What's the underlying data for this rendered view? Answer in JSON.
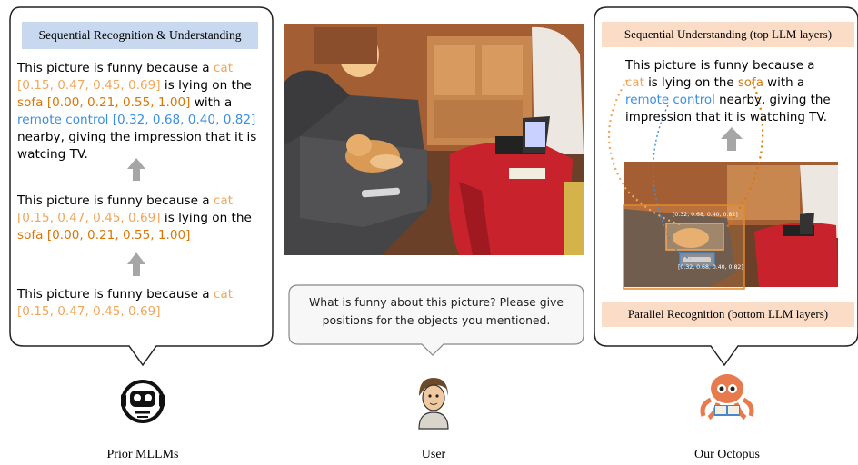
{
  "left_panel": {
    "header": "Sequential Recognition & Understanding",
    "block1": {
      "p1": "This picture is funny because a ",
      "cat": "cat",
      "cat_box": "[0.15, 0.47, 0.45, 0.69]",
      "p2": " is lying on the ",
      "sofa": "sofa",
      "sofa_box": "[0.00, 0.21, 0.55, 1.00]",
      "p3": " with a ",
      "remote": "remote control",
      "remote_box": "[0.32, 0.68, 0.40, 0.82]",
      "p4": "nearby, giving the impression that it is watcing TV."
    },
    "block2": {
      "p1": "This picture is funny because a ",
      "cat": "cat",
      "cat_box": "[0.15, 0.47, 0.45, 0.69]",
      "p2": " is lying on the",
      "sofa": "sofa",
      "sofa_box": "[0.00, 0.21, 0.55, 1.00]"
    },
    "block3": {
      "p1": "This picture is funny because a ",
      "cat": "cat",
      "cat_box": "[0.15, 0.47, 0.45, 0.69]"
    },
    "caption": "Prior MLLMs"
  },
  "middle_panel": {
    "question": "What is funny about this picture? Please give positions for the objects you mentioned.",
    "caption": "User"
  },
  "right_panel": {
    "top_header": "Sequential Understanding (top LLM layers)",
    "text": {
      "p1": "This picture is funny because a",
      "cat": "cat",
      "p2": " is lying on the ",
      "sofa": "sofa",
      "p3": " with a",
      "remote": "remote control",
      "p4": " nearby, giving the",
      "p5": "impression that it is watching TV."
    },
    "box_label_cat": "[0.32, 0.68, 0.40, 0.82]",
    "box_label_remote": "[0.32, 0.68, 0.40, 0.82]",
    "bottom_header": "Parallel Recognition (bottom LLM layers)",
    "caption": "Our Octopus"
  },
  "colors": {
    "cat": "#f2a65a",
    "sofa": "#d97706",
    "remote": "#3b8fe0",
    "blue_header": "#c8d8ee",
    "orange_header": "#fbdcc6"
  }
}
